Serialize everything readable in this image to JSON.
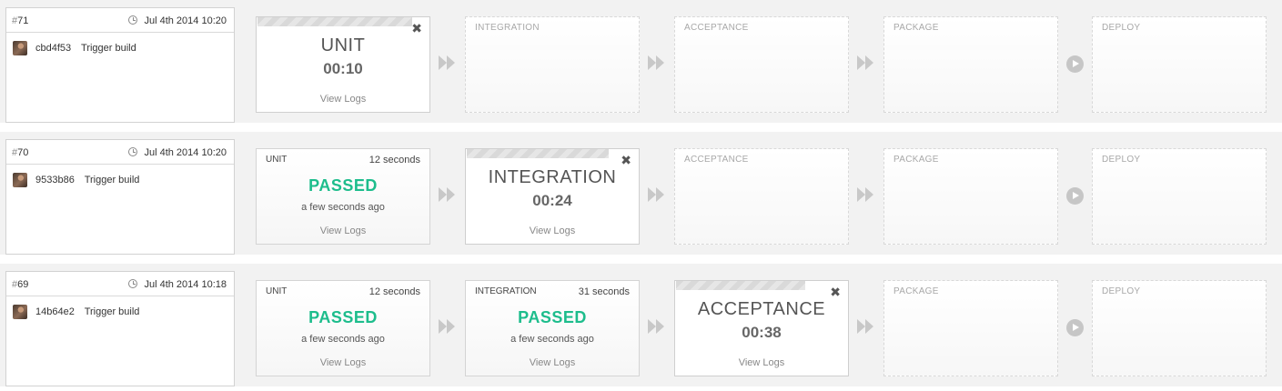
{
  "builds": [
    {
      "number": "71",
      "date": "Jul 4th 2014 10:20",
      "sha": "cbd4f53",
      "message": "Trigger build",
      "stages": [
        {
          "name": "UNIT",
          "state": "running",
          "timer": "00:10",
          "logs": "View Logs"
        },
        {
          "name": "INTEGRATION",
          "state": "pending"
        },
        {
          "name": "ACCEPTANCE",
          "state": "pending"
        },
        {
          "name": "PACKAGE",
          "state": "pending"
        },
        {
          "name": "DEPLOY",
          "state": "pending"
        }
      ]
    },
    {
      "number": "70",
      "date": "Jul 4th 2014 10:20",
      "sha": "9533b86",
      "message": "Trigger build",
      "stages": [
        {
          "name": "UNIT",
          "state": "passed",
          "duration": "12 seconds",
          "status": "PASSED",
          "ago": "a few seconds ago",
          "logs": "View Logs"
        },
        {
          "name": "INTEGRATION",
          "state": "running",
          "timer": "00:24",
          "logs": "View Logs"
        },
        {
          "name": "ACCEPTANCE",
          "state": "pending"
        },
        {
          "name": "PACKAGE",
          "state": "pending"
        },
        {
          "name": "DEPLOY",
          "state": "pending"
        }
      ]
    },
    {
      "number": "69",
      "date": "Jul 4th 2014 10:18",
      "sha": "14b64e2",
      "message": "Trigger build",
      "stages": [
        {
          "name": "UNIT",
          "state": "passed",
          "duration": "12 seconds",
          "status": "PASSED",
          "ago": "a few seconds ago",
          "logs": "View Logs"
        },
        {
          "name": "INTEGRATION",
          "state": "passed",
          "duration": "31 seconds",
          "status": "PASSED",
          "ago": "a few seconds ago",
          "logs": "View Logs"
        },
        {
          "name": "ACCEPTANCE",
          "state": "running",
          "timer": "00:38",
          "logs": "View Logs"
        },
        {
          "name": "PACKAGE",
          "state": "pending"
        },
        {
          "name": "DEPLOY",
          "state": "pending"
        }
      ]
    }
  ],
  "icons": {
    "close": "close-icon",
    "clock": "clock-icon",
    "arrow": "double-arrow-icon",
    "play": "play-icon"
  },
  "colors": {
    "passed": "#1dbd8c",
    "row_bg": "#f2f2f2"
  }
}
